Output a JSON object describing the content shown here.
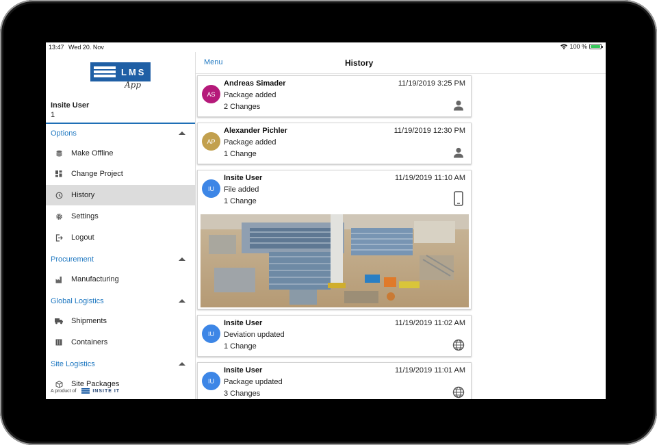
{
  "status_bar": {
    "time": "13:47",
    "date": "Wed 20. Nov",
    "battery": "100 %"
  },
  "logo": {
    "text": "LMS",
    "sub": "App"
  },
  "user": {
    "name": "Insite User",
    "id": "1"
  },
  "sidebar": {
    "sections": [
      {
        "label": "Options",
        "items": [
          {
            "label": "Make Offline",
            "icon": "database-icon"
          },
          {
            "label": "Change Project",
            "icon": "dashboard-icon"
          },
          {
            "label": "History",
            "icon": "history-icon",
            "active": true
          },
          {
            "label": "Settings",
            "icon": "gear-icon"
          },
          {
            "label": "Logout",
            "icon": "logout-icon"
          }
        ]
      },
      {
        "label": "Procurement",
        "items": [
          {
            "label": "Manufacturing",
            "icon": "factory-icon"
          }
        ]
      },
      {
        "label": "Global Logistics",
        "items": [
          {
            "label": "Shipments",
            "icon": "truck-icon"
          },
          {
            "label": "Containers",
            "icon": "container-icon"
          }
        ]
      },
      {
        "label": "Site Logistics",
        "items": [
          {
            "label": "Site Packages",
            "icon": "package-icon"
          }
        ]
      }
    ],
    "footer": {
      "prefix": "A product of",
      "brand": "INSITE IT"
    }
  },
  "navbar": {
    "menu_label": "Menu",
    "title": "History"
  },
  "history": [
    {
      "initials": "AS",
      "avatar_color": "#b5197a",
      "name": "Andreas Simader",
      "timestamp": "11/19/2019 3:25 PM",
      "action": "Package added",
      "changes": "2 Changes",
      "source_icon": "person-icon"
    },
    {
      "initials": "AP",
      "avatar_color": "#c2a04e",
      "name": "Alexander Pichler",
      "timestamp": "11/19/2019 12:30 PM",
      "action": "Package added",
      "changes": "1 Change",
      "source_icon": "person-icon"
    },
    {
      "initials": "IU",
      "avatar_color": "#3d86e6",
      "name": "Insite User",
      "timestamp": "11/19/2019 11:10 AM",
      "action": "File added",
      "changes": "1 Change",
      "source_icon": "mobile-icon",
      "has_photo": true
    },
    {
      "initials": "IU",
      "avatar_color": "#3d86e6",
      "name": "Insite User",
      "timestamp": "11/19/2019 11:02 AM",
      "action": "Deviation updated",
      "changes": "1 Change",
      "source_icon": "globe-icon"
    },
    {
      "initials": "IU",
      "avatar_color": "#3d86e6",
      "name": "Insite User",
      "timestamp": "11/19/2019 11:01 AM",
      "action": "Package updated",
      "changes": "3 Changes",
      "source_icon": "globe-icon"
    }
  ]
}
